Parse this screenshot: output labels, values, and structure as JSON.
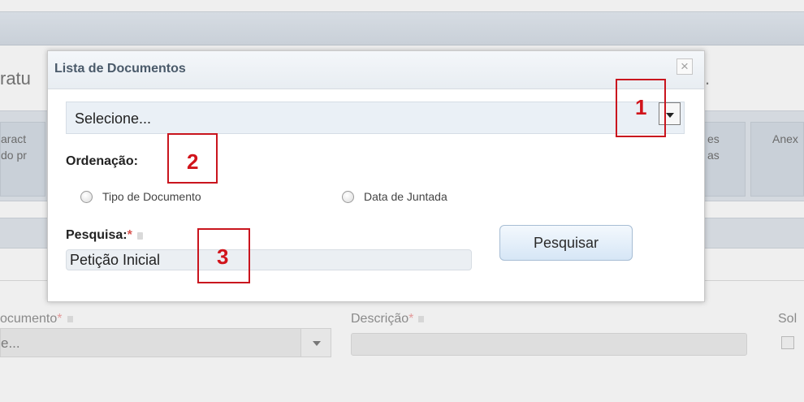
{
  "background": {
    "page_title": "ratu",
    "page_title_end": ".",
    "tabs": [
      {
        "line1": "aract",
        "line2": "do pr"
      },
      {
        "line1": "es",
        "line2": "as"
      },
      {
        "line1": "Anex",
        "line2": ""
      }
    ],
    "form": {
      "tipo_documento_label": "ocumento",
      "tipo_documento_value": "e...",
      "descricao_label": "Descrição",
      "sol_label": "Sol",
      "required_mark": "*"
    }
  },
  "modal": {
    "title": "Lista de Documentos",
    "close_glyph": "×",
    "select_documento": {
      "value": "Selecione..."
    },
    "ordenacao": {
      "label": "Ordenação:",
      "options": [
        "Tipo de Documento",
        "Data de Juntada"
      ]
    },
    "pesquisa": {
      "label": "Pesquisa:",
      "required_mark": "*",
      "value": "Petição Inicial"
    },
    "search_button": "Pesquisar"
  },
  "annotations": [
    "1",
    "2",
    "3"
  ],
  "colors": {
    "annotation_red": "#c9151e",
    "modal_header": "#e8edf2",
    "button_blue": "#d6e6f6"
  }
}
